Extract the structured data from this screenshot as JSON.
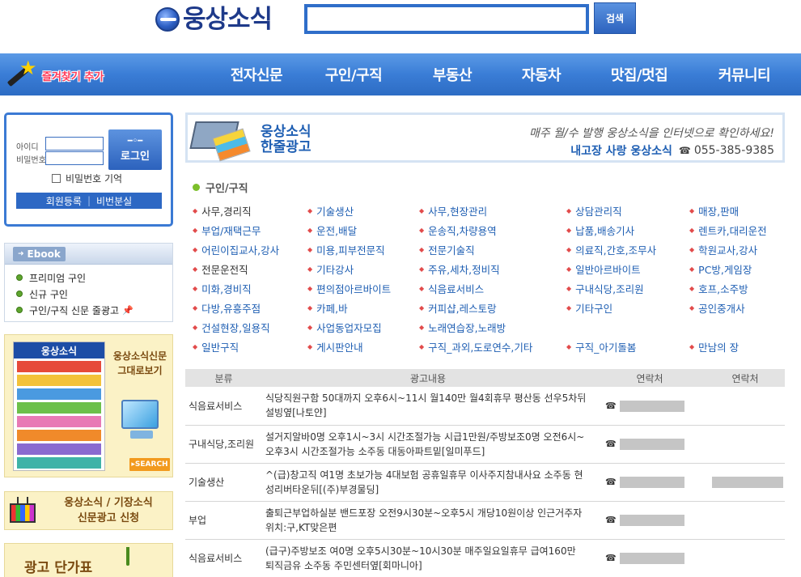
{
  "header": {
    "logo_text": "웅상소식",
    "search_placeholder": "",
    "search_button": "검색"
  },
  "nav": {
    "favorite_label": "즐겨찾기 추가",
    "menu": [
      {
        "label": "전자신문"
      },
      {
        "label": "구인/구직"
      },
      {
        "label": "부동산"
      },
      {
        "label": "자동차"
      },
      {
        "label": "맛집/멋집"
      },
      {
        "label": "커뮤니티"
      }
    ]
  },
  "login": {
    "id_label": "아이디",
    "pw_label": "비밀번호",
    "login_button": "로그인",
    "remember_label": "비밀번호 기억",
    "register": "회원등록",
    "find_password": "비번분실"
  },
  "ebook": {
    "title": "Ebook",
    "items": [
      {
        "label": "프리미엄 구인"
      },
      {
        "label": "신규 구인"
      },
      {
        "label": "구인/구직 신문 줄광고"
      }
    ]
  },
  "promo": {
    "paper_title_1": "웅상소식신문",
    "paper_title_2": "그대로보기",
    "paper_thumb": "웅상소식",
    "search_button": "SEARCH",
    "apply_line_1": "웅상소식 / 기장소식",
    "apply_line_2": "신문광고 신청",
    "price_title": "광고 단가표"
  },
  "banner": {
    "title_1": "웅상소식",
    "title_2": "한줄광고",
    "tagline": "매주 월/수 발행 웅상소식을 인터넷으로 확인하세요!",
    "brand": "내고장 사랑 웅상소식",
    "phone": "055-385-9385"
  },
  "category": {
    "heading": "구인/구직",
    "rows": [
      [
        "사무,경리직",
        "기술생산",
        "사무,현장관리",
        "상담관리직",
        "매장,판매"
      ],
      [
        "부업/재택근무",
        "운전,배달",
        "운송직,차량용역",
        "납품,배송기사",
        "렌트카,대리운전"
      ],
      [
        "어린이집교사,강사",
        "미용,피부전문직",
        "전문기술직",
        "의료직,간호,조무사",
        "학원교사,강사"
      ],
      [
        "전문운전직",
        "기타강사",
        "주유,세차,정비직",
        "일반아르바이트",
        "PC방,게임장"
      ],
      [
        "미화,경비직",
        "편의점아르바이트",
        "식음료서비스",
        "구내식당,조리원",
        "호프,소주방"
      ],
      [
        "다방,유흥주점",
        "카페,바",
        "커피샵,레스토랑",
        "기타구인",
        "공인중개사"
      ],
      [
        "건설현장,일용직",
        "사업동업자모집",
        "노래연습장,노래방"
      ],
      [
        "일반구직",
        "게시판안내",
        "구직_과외,도로연수,기타",
        "구직_아기돌봄",
        "만남의 장"
      ]
    ]
  },
  "table": {
    "headers": [
      "분류",
      "광고내용",
      "연락처",
      "연락처"
    ],
    "rows": [
      {
        "category": "식음료서비스",
        "content": "식당직원구함 50대까지 오후6시~11시 월140만 월4회휴무 평산동 선우5차뒤 설빙옆[나토얀]"
      },
      {
        "category": "구내식당,조리원",
        "content": "설거지알바0명 오후1시~3시 시간조절가능 시급1만원/주방보조0명 오전6시~오후3시 시간조절가능 소주동 대동아파트밑[일미푸드]"
      },
      {
        "category": "기술생산",
        "content": "^(급)창고직 여1명 초보가능 4대보험 공휴일휴무 이사주지참내사요 소주동 현성리버타운뒤[(주)부경물딩]"
      },
      {
        "category": "부업",
        "content": "출퇴근부업하실분 밴드포장 오전9시30분~오후5시 개당10원이상 인근거주자 위치:구,KT맞은편"
      },
      {
        "category": "식음료서비스",
        "content": "(급구)주방보조 여0명 오후5시30분~10시30분 매주일요일휴무 급여160만 퇴직금유 소주동 주민센터옆[회마니아]"
      }
    ]
  }
}
